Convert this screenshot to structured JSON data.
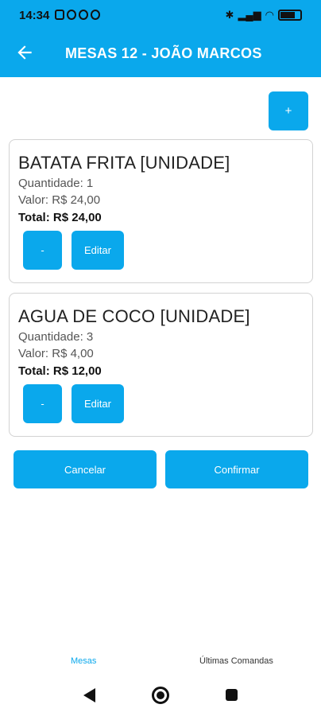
{
  "status_bar": {
    "time": "14:34",
    "battery_level": 0.75
  },
  "app_bar": {
    "title": "MESAS 12 - JOÃO MARCOS"
  },
  "actions": {
    "add_label": "+"
  },
  "items": [
    {
      "name": "BATATA FRITA [UNIDADE]",
      "quantity": "Quantidade: 1",
      "value": "Valor: R$ 24,00",
      "total": "Total: R$ 24,00",
      "minus_label": "-",
      "edit_label": "Editar"
    },
    {
      "name": "AGUA DE COCO [UNIDADE]",
      "quantity": "Quantidade: 3",
      "value": "Valor: R$ 4,00",
      "total": "Total: R$ 12,00",
      "minus_label": "-",
      "edit_label": "Editar"
    }
  ],
  "footer_actions": {
    "cancel_label": "Cancelar",
    "confirm_label": "Confirmar"
  },
  "bottom_nav": {
    "tabs": [
      {
        "label": "Mesas",
        "active": true
      },
      {
        "label": "Últimas Comandas",
        "active": false
      }
    ]
  },
  "colors": {
    "primary": "#0aa8ec",
    "text": "#222222",
    "card_border": "#d2d2d2"
  },
  "icons": {
    "back": "arrow-left-icon",
    "system_back": "triangle-back-icon",
    "system_home": "circle-home-icon",
    "system_recent": "square-recent-icon"
  }
}
